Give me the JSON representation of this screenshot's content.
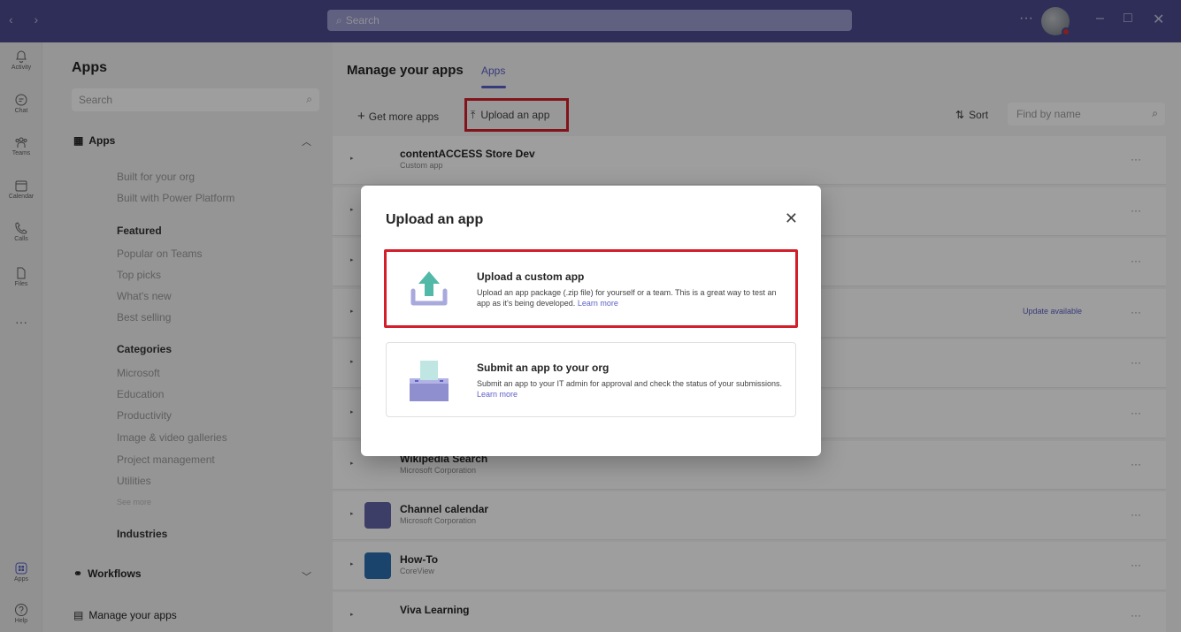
{
  "titlebar": {
    "nav_arrows": "‹ ›",
    "search_placeholder": "Search",
    "more": "···",
    "window_controls": [
      "–",
      "□",
      "✕"
    ]
  },
  "rail": {
    "items": [
      {
        "label": "Activity",
        "icon": "bell-icon"
      },
      {
        "label": "Chat",
        "icon": "chat-icon"
      },
      {
        "label": "Teams",
        "icon": "teams-icon"
      },
      {
        "label": "Calendar",
        "icon": "calendar-icon"
      },
      {
        "label": "Calls",
        "icon": "phone-icon"
      },
      {
        "label": "Files",
        "icon": "file-icon"
      },
      {
        "label": "···",
        "icon": "more-icon"
      }
    ],
    "bottom": [
      {
        "label": "Apps",
        "icon": "apps-icon"
      },
      {
        "label": "Help",
        "icon": "help-icon"
      }
    ]
  },
  "panel": {
    "title": "Apps",
    "search_placeholder": "Search",
    "apps_section": "Apps",
    "apps_items": [
      "Built for your org",
      "Built with Power Platform"
    ],
    "featured_head": "Featured",
    "featured_items": [
      "Popular on Teams",
      "Top picks",
      "What's new",
      "Best selling"
    ],
    "categories_head": "Categories",
    "categories_items": [
      "Microsoft",
      "Education",
      "Productivity",
      "Image & video galleries",
      "Project management",
      "Utilities"
    ],
    "see_more": "See more",
    "industries_head": "Industries",
    "workflows": "Workflows",
    "manage_apps": "Manage your apps"
  },
  "main": {
    "title": "Manage your apps",
    "tab": "Apps",
    "get_more": "Get more apps",
    "upload": "Upload an app",
    "sort": "Sort",
    "find_placeholder": "Find by name",
    "rows": [
      {
        "name": "contentACCESS Store Dev",
        "publisher": "Custom app",
        "color": "#ffffff"
      },
      {
        "name": "",
        "publisher": "",
        "color": "#ffffff"
      },
      {
        "name": "",
        "publisher": "",
        "color": "#ffffff"
      },
      {
        "name": "",
        "publisher": "",
        "color": "#ffffff",
        "update": "Update available"
      },
      {
        "name": "",
        "publisher": "",
        "color": "#ffffff"
      },
      {
        "name": "",
        "publisher": "",
        "color": "#ffffff"
      },
      {
        "name": "Wikipedia Search",
        "publisher": "Microsoft Corporation",
        "color": "#ffffff"
      },
      {
        "name": "Channel calendar",
        "publisher": "Microsoft Corporation",
        "color": "#6264a7"
      },
      {
        "name": "How-To",
        "publisher": "CoreView",
        "color": "#2c6fb0"
      },
      {
        "name": "Viva Learning",
        "publisher": "",
        "color": "#ffffff"
      }
    ]
  },
  "dialog": {
    "title": "Upload an app",
    "close": "✕",
    "card1": {
      "title": "Upload a custom app",
      "desc": "Upload an app package (.zip file) for yourself or a team. This is a great way to test an app as it's being developed.",
      "link": "Learn more"
    },
    "card2": {
      "title": "Submit an app to your org",
      "desc": "Submit an app to your IT admin for approval and check the status of your submissions.",
      "link": "Learn more"
    }
  },
  "colors": {
    "titlebar": "#4b4b8f",
    "accent": "#5b5fc7",
    "highlight": "#d21f2a",
    "upload_arrow": "#52b9a8"
  }
}
